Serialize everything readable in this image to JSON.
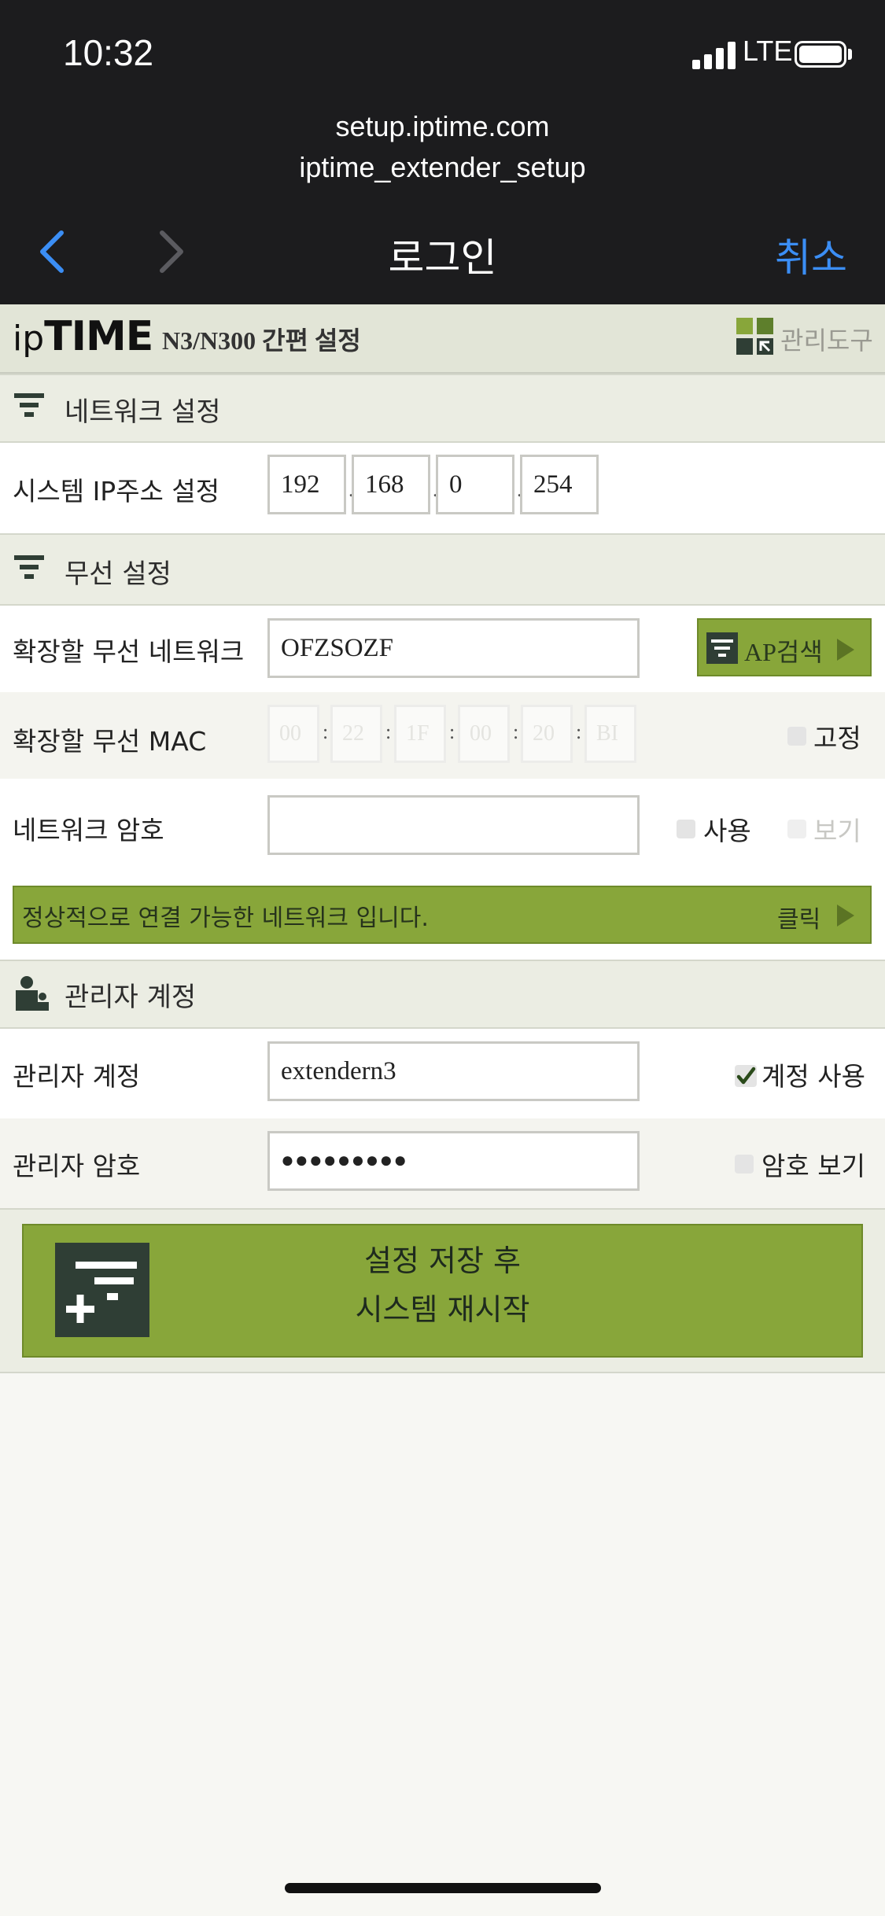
{
  "status": {
    "time": "10:32",
    "network": "LTE"
  },
  "browser": {
    "url_line1": "setup.iptime.com",
    "url_line2": "iptime_extender_setup",
    "title": "로그인",
    "cancel": "취소"
  },
  "header": {
    "brand_ip": "ip",
    "brand_time": "TIME",
    "model": "N3/N300 간편 설정",
    "admin_tool": "관리도구"
  },
  "network_section": {
    "title": "네트워크 설정",
    "ip_label": "시스템 IP주소 설정",
    "ip": [
      "192",
      "168",
      "0",
      "254"
    ]
  },
  "wireless_section": {
    "title": "무선 설정",
    "ssid_label": "확장할 무선 네트워크",
    "ssid_value": "OFZSOZF",
    "ap_search": "AP검색",
    "mac_label": "확장할 무선 MAC",
    "mac": [
      "00",
      "22",
      "1F",
      "00",
      "20",
      "BI"
    ],
    "fixed_label": "고정",
    "pw_label": "네트워크 암호",
    "pw_value": "",
    "use_label": "사용",
    "show_label": "보기",
    "notice": "정상적으로 연결 가능한 네트워크 입니다.",
    "notice_action": "클릭"
  },
  "admin_section": {
    "title": "관리자 계정",
    "account_label": "관리자 계정",
    "account_value": "extendern3",
    "account_use_label": "계정 사용",
    "account_use_checked": true,
    "pw_label": "관리자 암호",
    "pw_value": "●●●●●●●●●",
    "pw_show_label": "암호 보기"
  },
  "save": {
    "line1": "설정 저장 후",
    "line2": "시스템 재시작"
  },
  "colors": {
    "accent_green": "#88a63a",
    "nav_blue": "#3b8ef5",
    "dark": "#2f3e35"
  }
}
